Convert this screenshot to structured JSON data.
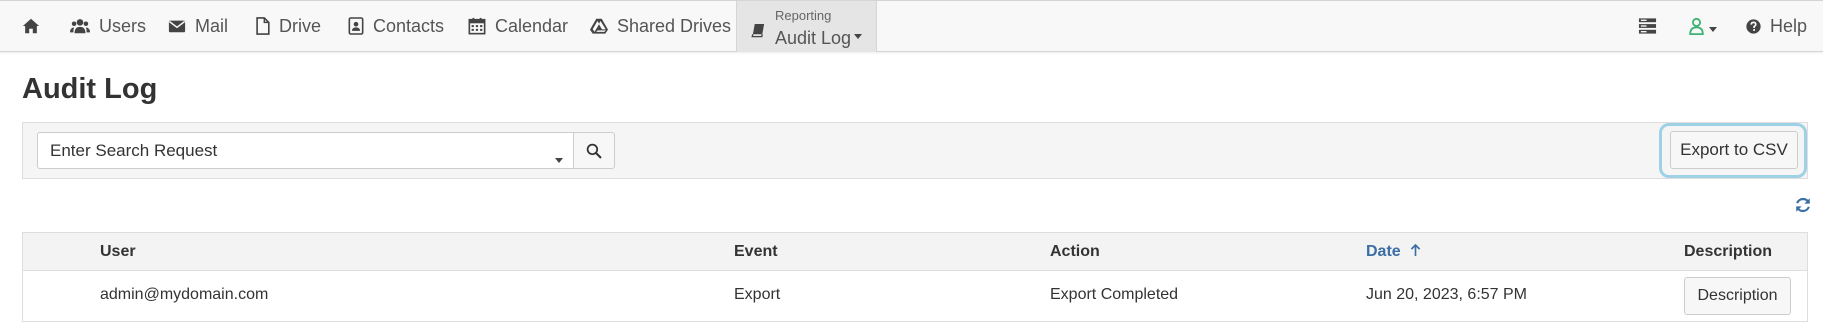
{
  "nav": {
    "home_icon": "home-icon",
    "users": "Users",
    "mail": "Mail",
    "drive": "Drive",
    "contacts": "Contacts",
    "calendar": "Calendar",
    "shared_drives": "Shared Drives",
    "reporting_section": "Reporting",
    "reporting_current": "Audit Log",
    "help": "Help",
    "user_status_color": "#3cb371",
    "active_tab_bg": "#e5e5e5"
  },
  "page": {
    "title": "Audit Log"
  },
  "toolbar": {
    "search_placeholder": "Enter Search Request",
    "export_label": "Export to CSV",
    "highlight_color": "#9fd1e6"
  },
  "table": {
    "columns": {
      "user": "User",
      "event": "Event",
      "action": "Action",
      "date": "Date",
      "description": "Description"
    },
    "sorted_column": "date",
    "sort_direction": "ascending",
    "rows": [
      {
        "user": "admin@mydomain.com",
        "event": "Export",
        "action": "Export Completed",
        "date": "Jun 20, 2023, 6:57 PM",
        "description_button": "Description"
      }
    ]
  }
}
